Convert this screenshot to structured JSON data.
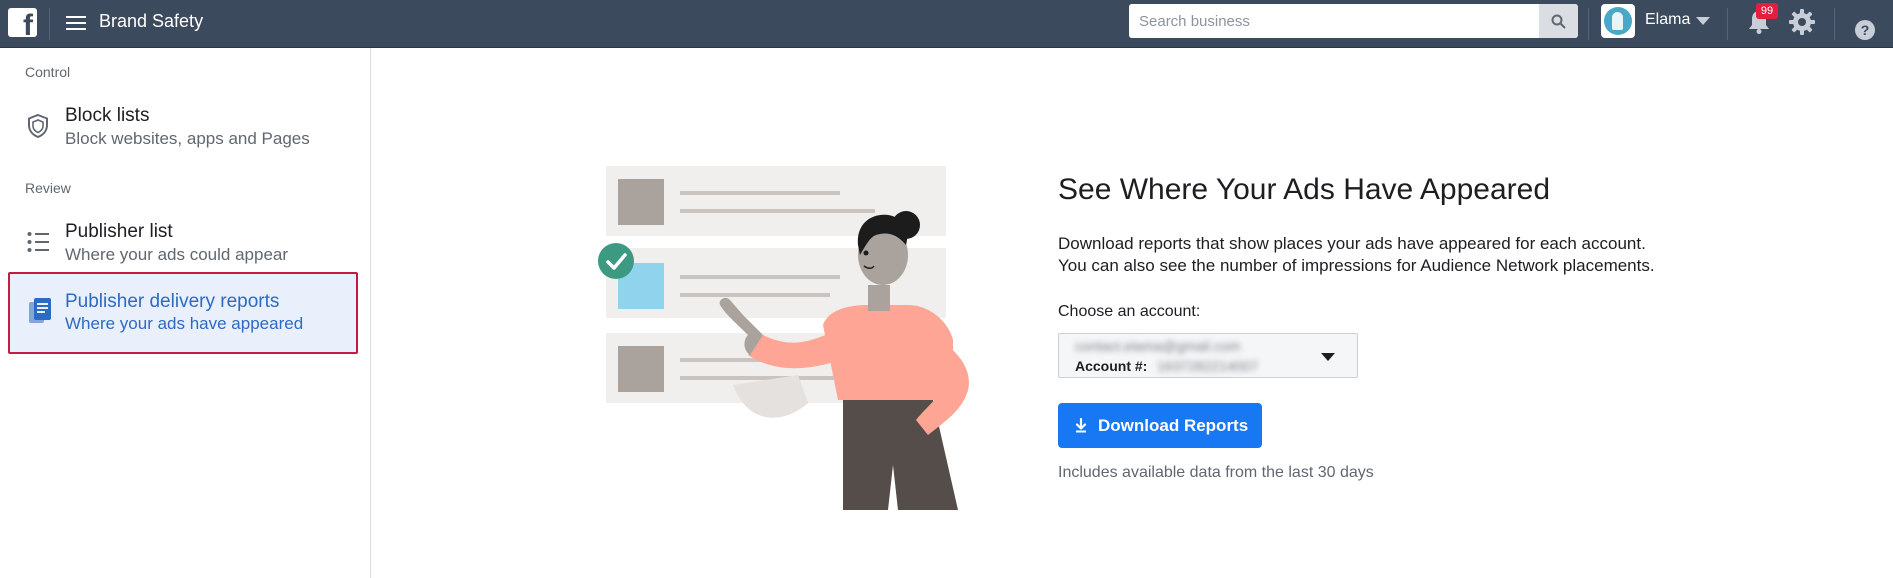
{
  "header": {
    "logo": "f",
    "app_title": "Brand Safety",
    "search": {
      "placeholder": "Search business",
      "value": ""
    },
    "user_name": "Elama",
    "notification_count": "99",
    "help_label": "?"
  },
  "sidebar": {
    "sections": [
      {
        "label": "Control",
        "items": [
          {
            "title": "Block lists",
            "subtitle": "Block websites, apps and Pages",
            "icon": "shield-icon"
          }
        ]
      },
      {
        "label": "Review",
        "items": [
          {
            "title": "Publisher list",
            "subtitle": "Where your ads could appear",
            "icon": "list-icon"
          },
          {
            "title": "Publisher delivery reports",
            "subtitle": "Where your ads have appeared",
            "icon": "report-icon",
            "active": true
          }
        ]
      }
    ]
  },
  "main": {
    "headline": "See Where Your Ads Have Appeared",
    "description_line1": "Download reports that show places your ads have appeared for each account.",
    "description_line2": "You can also see the number of impressions for Audience Network placements.",
    "choose_label": "Choose an account:",
    "account": {
      "email": "contact.elama@gmail.com",
      "id_label": "Account #:",
      "id_value": "1637282214007"
    },
    "download_button": "Download Reports",
    "note": "Includes available data from the last 30 days"
  },
  "colors": {
    "topbar": "#3b4a5c",
    "accent": "#1877f2",
    "active_text": "#2d6ac1",
    "highlight_border": "#c21b44"
  }
}
